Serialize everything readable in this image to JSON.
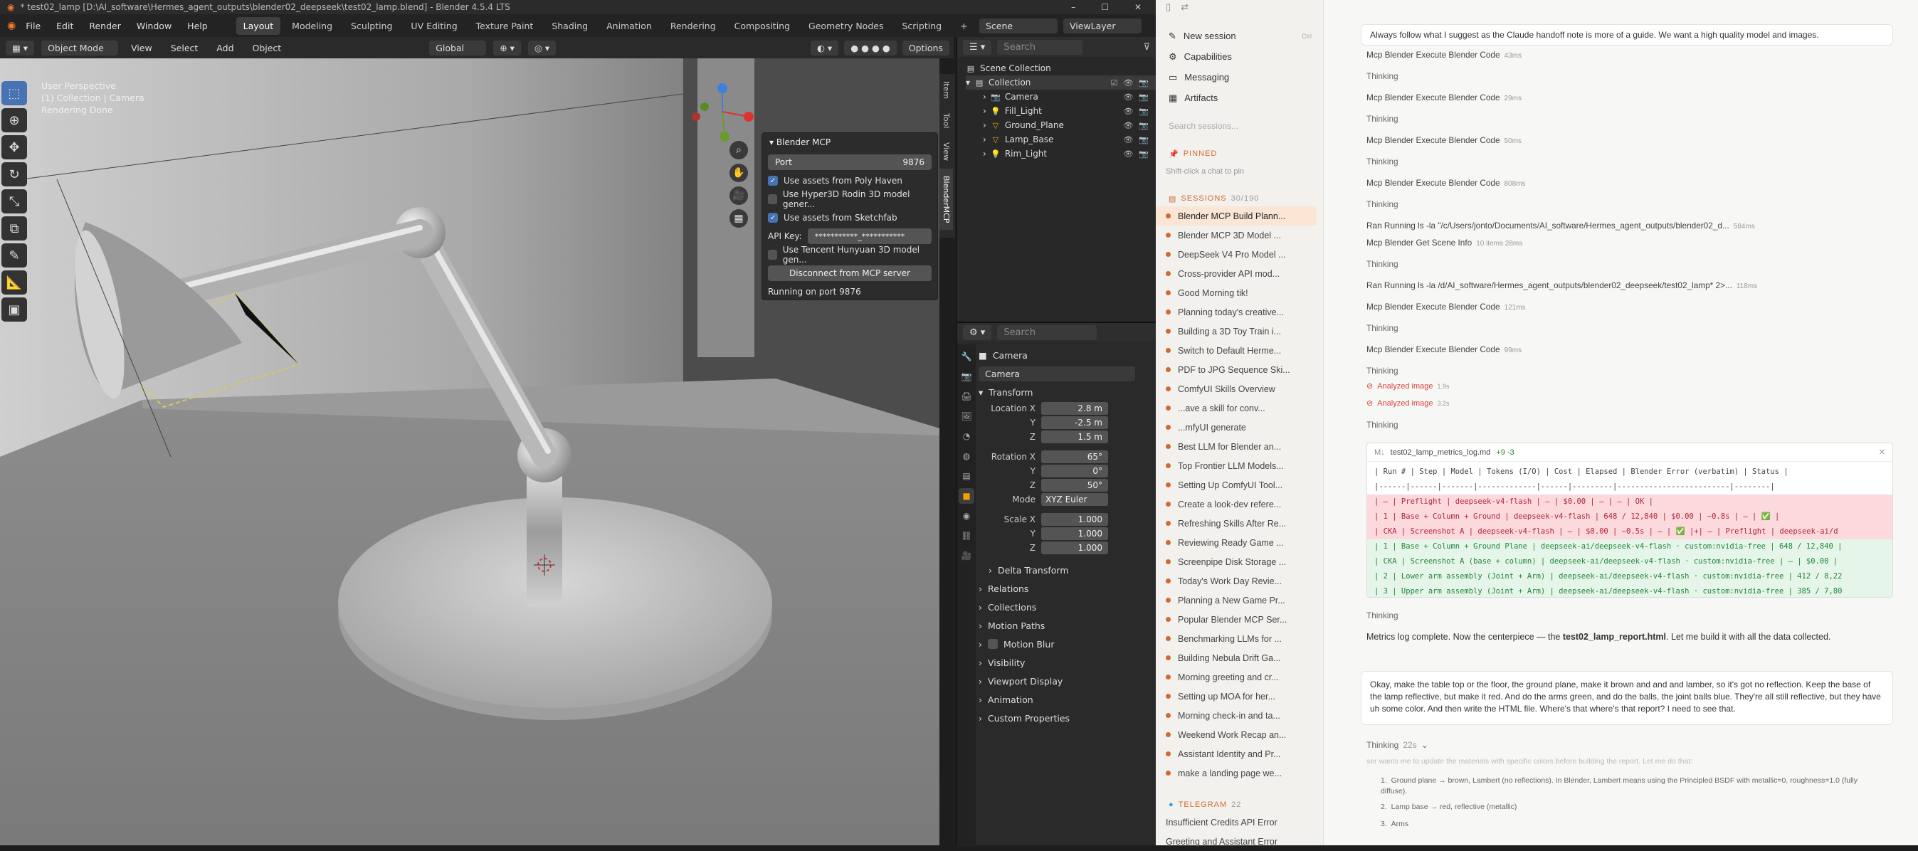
{
  "blender": {
    "title": "* test02_lamp [D:\\AI_software\\Hermes_agent_outputs\\blender02_deepseek\\test02_lamp.blend] - Blender 4.5.4 LTS",
    "menu": [
      "File",
      "Edit",
      "Render",
      "Window",
      "Help"
    ],
    "workspaces": [
      "Layout",
      "Modeling",
      "Sculpting",
      "UV Editing",
      "Texture Paint",
      "Shading",
      "Animation",
      "Rendering",
      "Compositing",
      "Geometry Nodes",
      "Scripting"
    ],
    "active_workspace": "Layout",
    "scene": "Scene",
    "view_layer": "ViewLayer",
    "header": {
      "mode": "Object Mode",
      "items": [
        "View",
        "Select",
        "Add",
        "Object"
      ],
      "orientation": "Global",
      "options": "Options"
    },
    "viewport_info": [
      "User Perspective",
      "(1) Collection | Camera",
      "Rendering Done"
    ],
    "mcp": {
      "title": "Blender MCP",
      "port_label": "Port",
      "port": "9876",
      "checks": [
        {
          "label": "Use assets from Poly Haven",
          "on": true
        },
        {
          "label": "Use Hyper3D Rodin 3D model gener...",
          "on": false
        },
        {
          "label": "Use assets from Sketchfab",
          "on": true
        }
      ],
      "api_label": "API Key:",
      "api_value": "***********_***********",
      "tencent": "Use Tencent Hunyuan 3D model gen...",
      "disconnect": "Disconnect from MCP server",
      "status": "Running on port 9876"
    },
    "side_tabs": [
      "Item",
      "Tool",
      "View",
      "BlenderMCP"
    ],
    "search_placeholder": "Search",
    "outliner": {
      "root": "Scene Collection",
      "collection": "Collection",
      "items": [
        "Camera",
        "Fill_Light",
        "Ground_Plane",
        "Lamp_Base",
        "Rim_Light"
      ]
    },
    "props": {
      "object": "Camera",
      "datablock": "Camera",
      "transform": "Transform",
      "location": {
        "label": "Location X",
        "x": "2.8 m",
        "y": "-2.5 m",
        "z": "1.5 m"
      },
      "rotation": {
        "label": "Rotation X",
        "x": "65°",
        "y": "0°",
        "z": "50°"
      },
      "mode_label": "Mode",
      "mode": "XYZ Euler",
      "scale": {
        "label": "Scale X",
        "x": "1.000",
        "y": "1.000",
        "z": "1.000"
      },
      "axis": {
        "y": "Y",
        "z": "Z"
      },
      "sections": [
        "Delta Transform",
        "Relations",
        "Collections",
        "Motion Paths",
        "Motion Blur",
        "Visibility",
        "Viewport Display",
        "Animation",
        "Custom Properties"
      ]
    }
  },
  "app": {
    "nav": [
      "New session",
      "Capabilities",
      "Messaging",
      "Artifacts"
    ],
    "new_shortcut": "Ctrl",
    "search_sessions": "Search sessions...",
    "pinned_label": "PINNED",
    "pinned_hint": "Shift-click a chat to pin",
    "sessions_label": "SESSIONS",
    "sessions_count": "30/190",
    "sessions": [
      "Blender MCP Build Plann...",
      "Blender MCP 3D Model ...",
      "DeepSeek V4 Pro Model ...",
      "Cross-provider API mod...",
      "Good Morning tik!",
      "Planning today's creative...",
      "Building a 3D Toy Train i...",
      "Switch to Default Herme...",
      "PDF to JPG Sequence Ski...",
      "ComfyUI Skills Overview",
      "...ave a skill for conv...",
      "...mfyUI generate",
      "Best LLM for Blender an...",
      "Top Frontier LLM Models...",
      "Setting Up ComfyUI Tool...",
      "Create a look-dev refere...",
      "Refreshing Skills After Re...",
      "Reviewing Ready Game ...",
      "Screenpipe Disk Storage ...",
      "Today's Work Day Revie...",
      "Planning a New Game Pr...",
      "Popular Blender MCP Ser...",
      "Benchmarking LLMs for ...",
      "Building Nebula Drift Ga...",
      "Morning greeting and cr...",
      "Setting up MOA for her...",
      "Morning check-in and ta...",
      "Weekend Work Recap an...",
      "Assistant Identity and Pr...",
      "make a landing page we..."
    ],
    "telegram_label": "TELEGRAM",
    "telegram_count": "22",
    "telegram": [
      "Insufficient Credits API Error",
      "Greeting and Assistant Error"
    ],
    "note": "Always follow what I suggest as the Claude handoff note is more of a guide. We want a high quality model and images.",
    "steps": [
      {
        "t": "Mcp Blender Execute Blender Code",
        "ms": "43ms"
      },
      {
        "t": "Thinking"
      },
      {
        "t": "Mcp Blender Execute Blender Code",
        "ms": "29ms"
      },
      {
        "t": "Thinking"
      },
      {
        "t": "Mcp Blender Execute Blender Code",
        "ms": "50ms"
      },
      {
        "t": "Thinking"
      },
      {
        "t": "Mcp Blender Execute Blender Code",
        "ms": "808ms"
      },
      {
        "t": "Thinking"
      },
      {
        "t": "Ran Running ls -la \"/c/Users/jonto/Documents/AI_software/Hermes_agent_outputs/blender02_d...",
        "ms": "584ms"
      },
      {
        "t": "Mcp Blender Get Scene Info",
        "ms": "10 items 28ms"
      },
      {
        "t": "Thinking"
      },
      {
        "t": "Ran Running ls -la /d/AI_software/Hermes_agent_outputs/blender02_deepseek/test02_lamp* 2>...",
        "ms": "118ms"
      },
      {
        "t": "Mcp Blender Execute Blender Code",
        "ms": "121ms"
      },
      {
        "t": "Thinking"
      },
      {
        "t": "Mcp Blender Execute Blender Code",
        "ms": "99ms"
      },
      {
        "t": "Thinking"
      }
    ],
    "analyzed": [
      {
        "t": "Analyzed image",
        "ms": "1.9s"
      },
      {
        "t": "Analyzed image",
        "ms": "3.2s"
      }
    ],
    "thinking3": "Thinking",
    "file": {
      "name": "test02_lamp_metrics_log.md",
      "diff": "+9 -3"
    },
    "code": [
      "| Run # | Step | Model | Tokens (I/O) | Cost | Elapsed | Blender Error (verbatim) | Status |",
      "|------|------|-------|-------------|------|---------|-------------------------|--------|",
      "| — | Preflight | deepseek-v4-flash | — | $0.00 | — | — | OK |",
      "| 1 | Base + Column + Ground | deepseek-v4-flash | 648 / 12,840 | $0.00 | ~0.8s | — | ✅ |",
      "| CKA | Screenshot A | deepseek-v4-flash | — | $0.00 | ~0.5s | — | ✅ |+| — | Preflight | deepseek-ai/d",
      "| 1 | Base + Column + Ground Plane | deepseek-ai/deepseek-v4-flash · custom:nvidia-free | 648 / 12,840 |",
      "| CKA | Screenshot A (base + column) | deepseek-ai/deepseek-v4-flash · custom:nvidia-free | — | $0.00 |",
      "| 2 | Lower arm assembly (Joint + Arm) | deepseek-ai/deepseek-v4-flash · custom:nvidia-free | 412 / 8,22",
      "| 3 | Upper arm assembly (Joint + Arm) | deepseek-ai/deepseek-v4-flash · custom:nvidia-free | 385 / 7,80"
    ],
    "thinking4": "Thinking",
    "complete_pre": "Metrics log complete. Now the centerpiece — the ",
    "complete_file": "test02_lamp_report.html",
    "complete_post": ". Let me build it with all the data collected.",
    "user_msg": "Okay, make the table top or the floor, the ground plane, make it brown and and and lamber, so it's got no reflection. Keep the base of the lamp reflective, but make it red. And do the arms green, and do the balls, the joint balls blue. They're all still reflective, but they have uh some color. And then write the HTML file. Where's that where's that report? I need to see that.",
    "thinking_final": "Thinking",
    "thinking_time": "22s",
    "faded": "ser wants me to update the materials with specific colors before building the report. Let me do that:",
    "bullets": [
      "Ground plane → brown, Lambert (no reflections). In Blender, Lambert means using the Principled BSDF with metallic=0, roughness=1.0 (fully diffuse).",
      "Lamp base → red, reflective (metallic)",
      "Arms"
    ]
  }
}
